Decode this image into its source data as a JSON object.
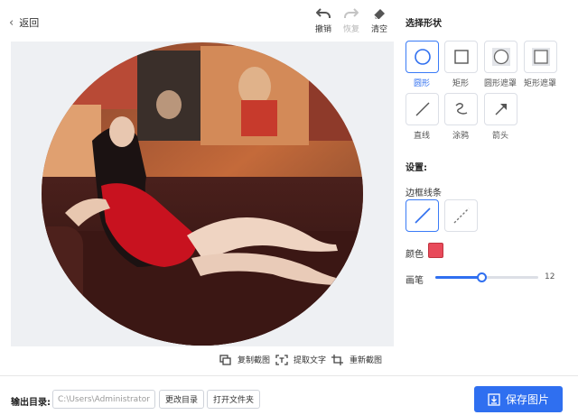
{
  "header": {
    "back_label": "返回",
    "undo_label": "撤销",
    "redo_label": "恢复",
    "clear_label": "清空"
  },
  "canvas": {
    "actions": {
      "copy_label": "复制截图",
      "extract_label": "提取文字",
      "recapture_label": "重新截图"
    }
  },
  "panel": {
    "shape_title": "选择形状",
    "shapes": [
      {
        "label": "圆形",
        "icon": "circle-icon",
        "active": true
      },
      {
        "label": "矩形",
        "icon": "rectangle-icon",
        "active": false
      },
      {
        "label": "圆形遮罩",
        "icon": "circle-mask-icon",
        "active": false
      },
      {
        "label": "矩形遮罩",
        "icon": "rectangle-mask-icon",
        "active": false
      },
      {
        "label": "直线",
        "icon": "line-icon",
        "active": false
      },
      {
        "label": "涂鸦",
        "icon": "scribble-icon",
        "active": false
      },
      {
        "label": "箭头",
        "icon": "arrow-icon",
        "active": false
      }
    ],
    "settings_title": "设置:",
    "border_label": "边框线条",
    "border_styles": [
      {
        "icon": "solid-line-icon",
        "active": true
      },
      {
        "icon": "dashed-line-icon",
        "active": false
      }
    ],
    "color_label": "颜色",
    "color_value": "#e84a5a",
    "brush_label": "画笔",
    "brush_size": "12",
    "brush_fraction": 0.45
  },
  "footer": {
    "output_label": "输出目录:",
    "path_value": "C:\\Users\\Administrator\\",
    "change_dir_label": "更改目录",
    "open_folder_label": "打开文件夹",
    "save_label": "保存图片"
  },
  "colors": {
    "accent": "#2f6ff0",
    "border": "#dcdfe6",
    "canvas_bg": "#eef0f3"
  }
}
